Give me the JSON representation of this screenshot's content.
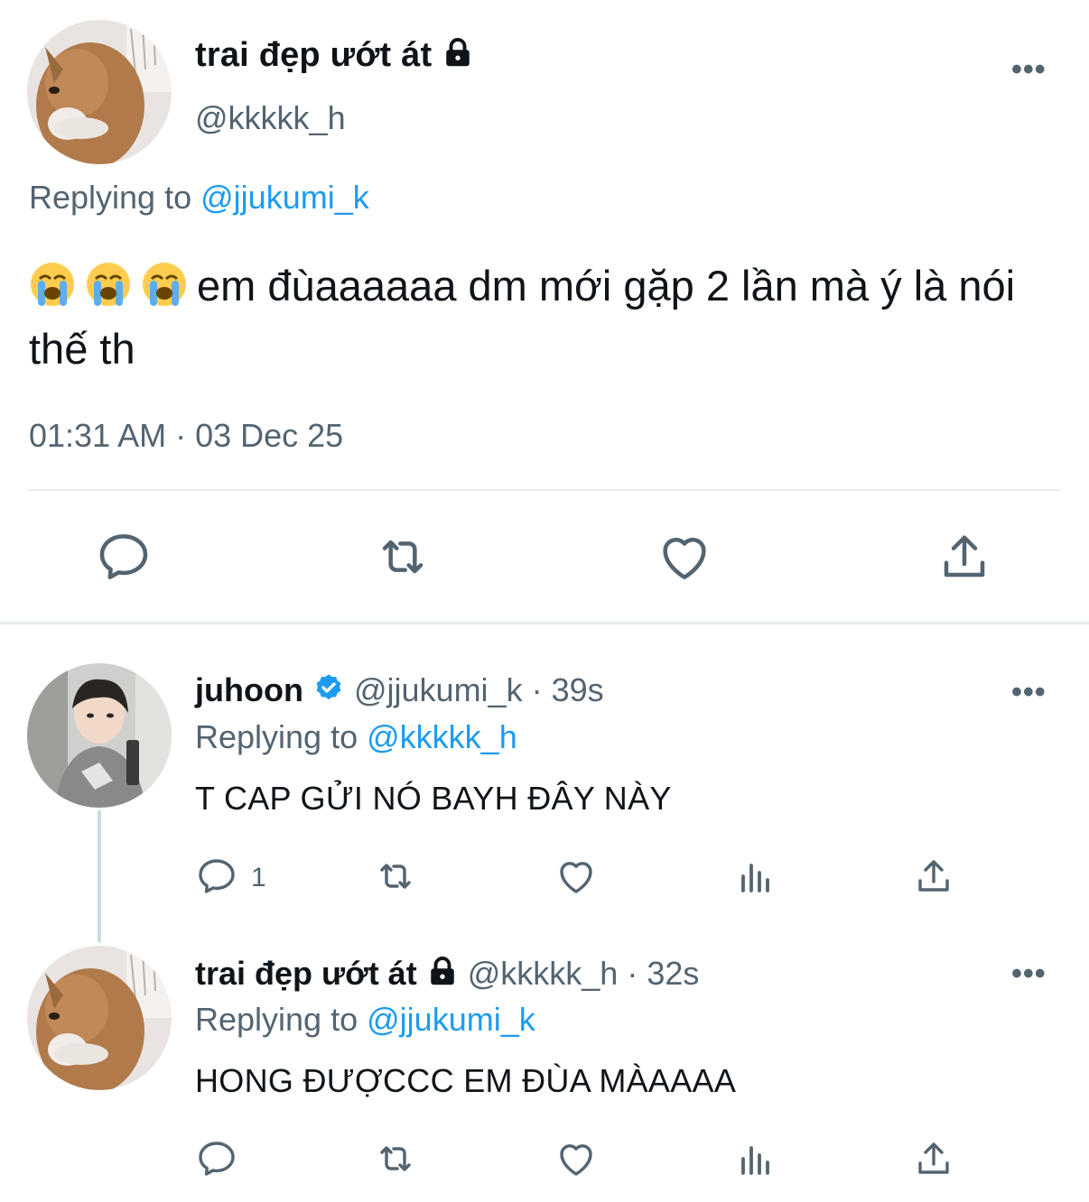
{
  "main_tweet": {
    "display_name": "trai đẹp ướt át",
    "handle": "@kkkkk_h",
    "replying_prefix": "Replying to",
    "replying_to": "@jjukumi_k",
    "text": "em đùaaaaaa dm mới gặp 2 lần mà ý là nói thế th",
    "emoji": [
      "loudly-crying-face",
      "loudly-crying-face",
      "loudly-crying-face"
    ],
    "timestamp": "01:31 AM · 03 Dec 25",
    "more_label": "•••"
  },
  "replies": [
    {
      "display_name": "juhoon",
      "verified": true,
      "handle": "@jjukumi_k",
      "time": "· 39s",
      "replying_prefix": "Replying to",
      "replying_to": "@kkkkk_h",
      "text": "T CAP GỬI NÓ BAYH ĐÂY NÀY",
      "reply_count": "1",
      "more_label": "•••"
    },
    {
      "display_name": "trai đẹp ướt át",
      "verified": false,
      "handle": "@kkkkk_h",
      "time": "· 32s",
      "replying_prefix": "Replying to",
      "replying_to": "@jjukumi_k",
      "text": "HONG ĐƯỢCCC EM ĐÙA MÀAAAA",
      "reply_count": "",
      "more_label": "•••"
    }
  ],
  "icons": {
    "reply": "reply-icon",
    "retweet": "retweet-icon",
    "like": "heart-icon",
    "views": "views-icon",
    "share": "share-icon",
    "lock": "lock-icon",
    "verified": "verified-badge-icon"
  },
  "colors": {
    "accent": "#1d9bf0",
    "muted": "#536471",
    "text": "#0f1419",
    "divider": "#e8ecef"
  }
}
